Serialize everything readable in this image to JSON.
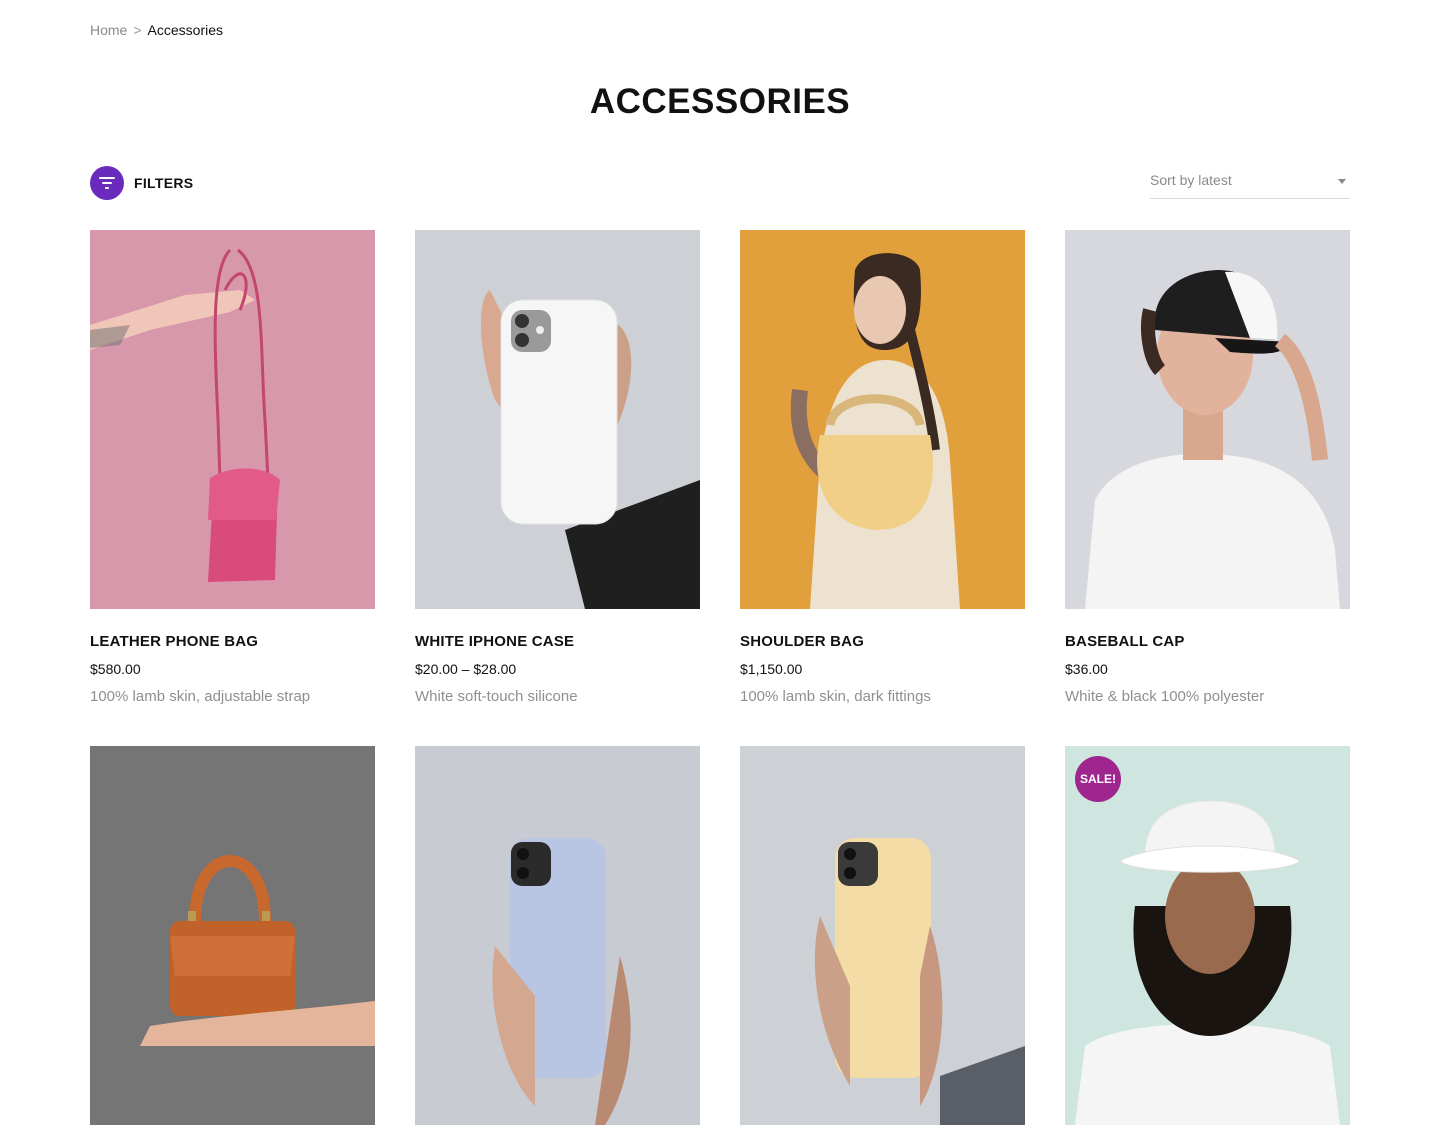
{
  "breadcrumb": {
    "home": "Home",
    "separator": ">",
    "current": "Accessories"
  },
  "page_title": "ACCESSORIES",
  "filters": {
    "label": "FILTERS",
    "icon": "filter-icon",
    "accent": "#6a2bbd"
  },
  "sort": {
    "selected": "Sort by latest"
  },
  "products": [
    {
      "title": "LEATHER PHONE BAG",
      "price": "$580.00",
      "desc": "100% lamb skin, adjustable strap"
    },
    {
      "title": "WHITE IPHONE CASE",
      "price": "$20.00 – $28.00",
      "desc": "White soft-touch silicone"
    },
    {
      "title": "SHOULDER BAG",
      "price": "$1,150.00",
      "desc": "100% lamb skin, dark fittings"
    },
    {
      "title": "BASEBALL CAP",
      "price": "$36.00",
      "desc": "White & black 100% polyester"
    }
  ],
  "row2": [
    {
      "image": "orange-handbag"
    },
    {
      "image": "blue-phone-case"
    },
    {
      "image": "yellow-phone-case"
    },
    {
      "image": "bucket-hat",
      "badge": "SALE!"
    }
  ],
  "colors": {
    "sale_badge": "#a0268f"
  }
}
